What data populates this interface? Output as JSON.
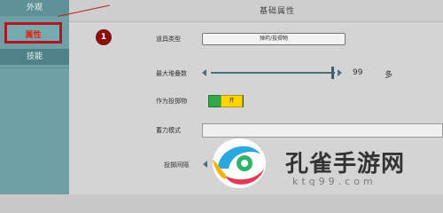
{
  "sidebar": {
    "items": [
      {
        "label": "外观"
      },
      {
        "label": "属性"
      },
      {
        "label": "技能"
      }
    ]
  },
  "panel": {
    "title": "基础属性",
    "rows": {
      "type_label": "道具类型",
      "type_value": "弹药/投掷物",
      "max_stack_label": "最大堆叠数",
      "max_stack_value": "99",
      "max_stack_unit": "多",
      "throwable_label": "作为投掷物",
      "throwable_toggle_text": "开",
      "charge_label": "蓄力模式",
      "interval_label": "投掷间隔"
    }
  },
  "callout": {
    "number": "1"
  },
  "watermark": {
    "text": "孔雀手游网",
    "sub": "ktq99.com"
  },
  "colors": {
    "sidebar": "#6fa0a6",
    "highlight": "#b5151d",
    "toggle_on": "#2fa84a",
    "toggle_knob": "#ffd400"
  }
}
